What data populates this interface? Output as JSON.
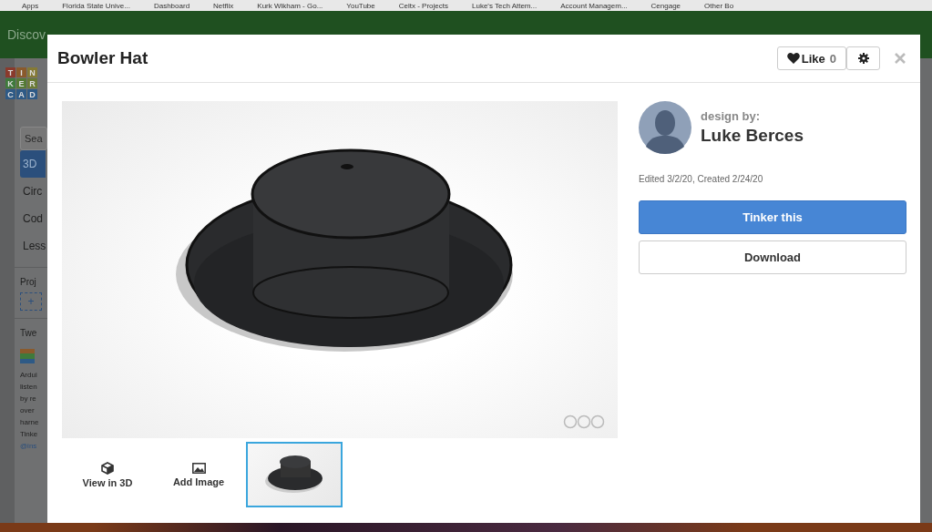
{
  "bookmarks": [
    "Apps",
    "Florida State Unive...",
    "Dashboard",
    "Netflix",
    "Kurk Wikham - Go...",
    "YouTube",
    "Celtx - Projects",
    "Luke's Tech Attem...",
    "Account Managem...",
    "Cengage",
    "Other Bo"
  ],
  "banner": {
    "text": "Discov"
  },
  "sidebar": {
    "logo": [
      "T",
      "I",
      "N",
      "K",
      "E",
      "R",
      "C",
      "A",
      "D"
    ],
    "search_placeholder": "Sea",
    "items": [
      {
        "label": "3D",
        "selected": true
      },
      {
        "label": "Circ",
        "selected": false
      },
      {
        "label": "Cod",
        "selected": false
      },
      {
        "label": "Less",
        "selected": false
      }
    ],
    "projects_heading": "Proj",
    "add_button": "+",
    "tweets_heading": "Twe",
    "tweet_lines": [
      "Ardui",
      "listen",
      "by re",
      "over",
      "harne",
      "Tinke"
    ],
    "tweet_link": "@ins"
  },
  "modal": {
    "title": "Bowler Hat",
    "like_label": "Like",
    "like_count": "0",
    "designer_label": "design by:",
    "designer": "Luke Berces",
    "dates": "Edited 3/2/20, Created 2/24/20",
    "primary_button": "Tinker this",
    "secondary_button": "Download",
    "actions": [
      {
        "kind": "cube",
        "label": "View in 3D"
      },
      {
        "kind": "image",
        "label": "Add Image"
      }
    ],
    "thumbnails": [
      {
        "selected": true
      }
    ]
  }
}
